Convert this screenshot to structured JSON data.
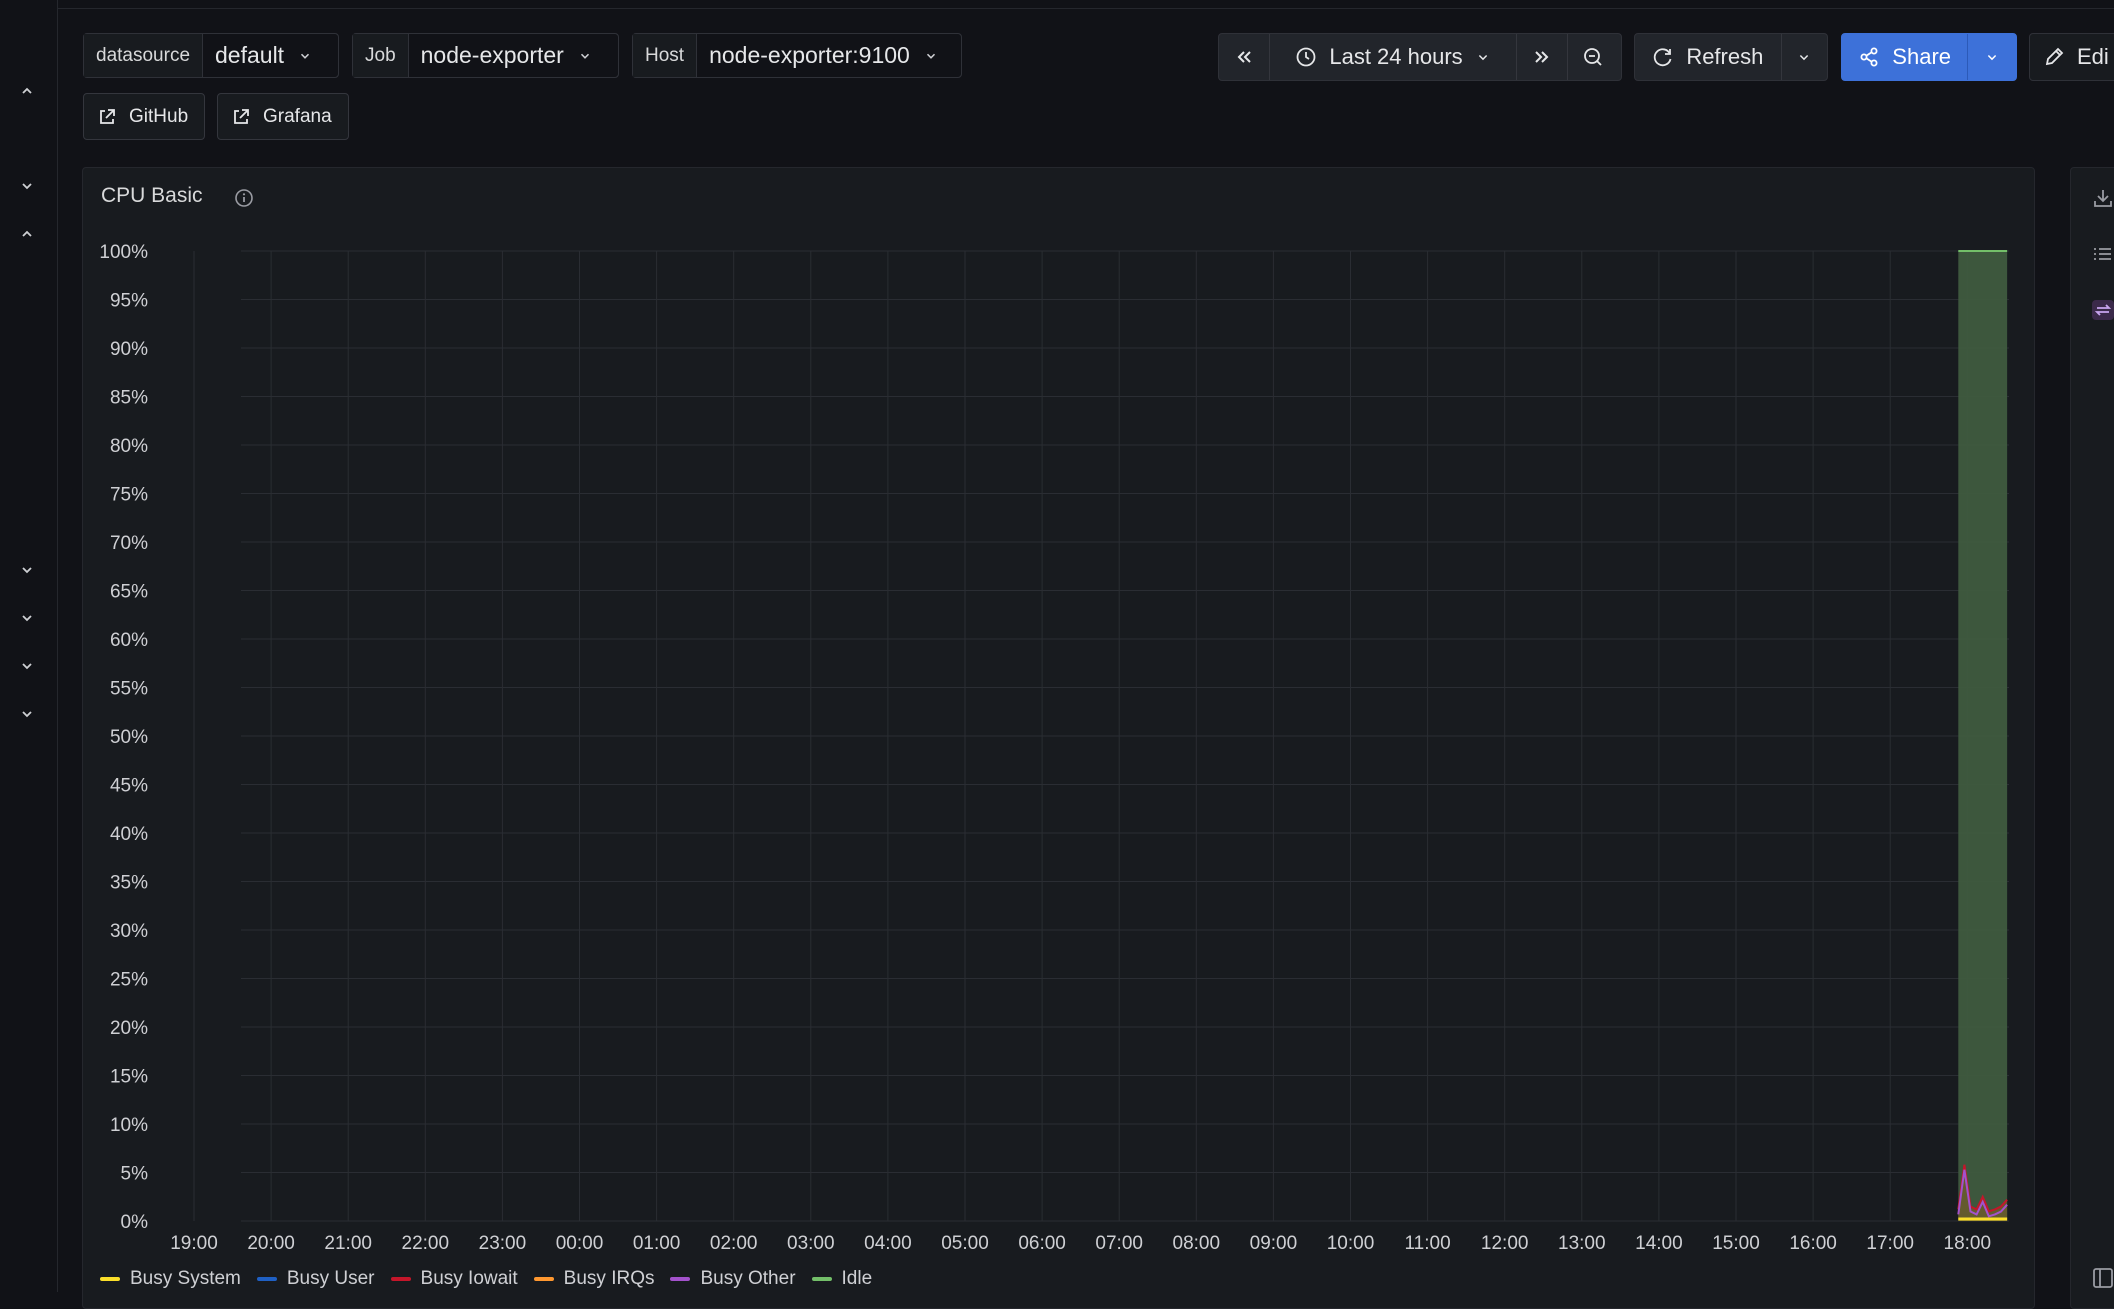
{
  "variables": [
    {
      "label": "datasource",
      "value": "default"
    },
    {
      "label": "Job",
      "value": "node-exporter"
    },
    {
      "label": "Host",
      "value": "node-exporter:9100"
    }
  ],
  "links": [
    {
      "label": "GitHub",
      "icon": "external-link-icon"
    },
    {
      "label": "Grafana",
      "icon": "external-link-icon"
    }
  ],
  "toolbar": {
    "time_range": "Last 24 hours",
    "refresh_label": "Refresh",
    "share_label": "Share",
    "edit_label": "Edi"
  },
  "colors": {
    "accent": "#3d71d9",
    "idle_fill": "#3f5b3f",
    "idle_line": "#73bf69"
  },
  "panel": {
    "title": "CPU Basic"
  },
  "chart_data": {
    "type": "area",
    "title": "CPU Basic",
    "y_ticks": [
      "100%",
      "95%",
      "90%",
      "85%",
      "80%",
      "75%",
      "70%",
      "65%",
      "60%",
      "55%",
      "50%",
      "45%",
      "40%",
      "35%",
      "30%",
      "25%",
      "20%",
      "15%",
      "10%",
      "5%",
      "0%"
    ],
    "x_ticks": [
      "19:00",
      "20:00",
      "21:00",
      "22:00",
      "23:00",
      "00:00",
      "01:00",
      "02:00",
      "03:00",
      "04:00",
      "05:00",
      "06:00",
      "07:00",
      "08:00",
      "09:00",
      "10:00",
      "11:00",
      "12:00",
      "13:00",
      "14:00",
      "15:00",
      "16:00",
      "17:00",
      "18:00"
    ],
    "ylim": [
      0,
      100
    ],
    "series": [
      {
        "name": "Busy System",
        "color": "#fade2a"
      },
      {
        "name": "Busy User",
        "color": "#1f60c4"
      },
      {
        "name": "Busy Iowait",
        "color": "#c4162a"
      },
      {
        "name": "Busy IRQs",
        "color": "#ff9830"
      },
      {
        "name": "Busy Other",
        "color": "#a352cc"
      },
      {
        "name": "Idle",
        "color": "#73bf69"
      }
    ],
    "data_window": {
      "start": "17:53",
      "end": "18:31"
    },
    "busy_total": [
      1.2,
      5.8,
      1.5,
      1.2,
      2.5,
      1.0,
      1.2,
      1.5,
      2.2
    ],
    "idle_value": 100
  }
}
